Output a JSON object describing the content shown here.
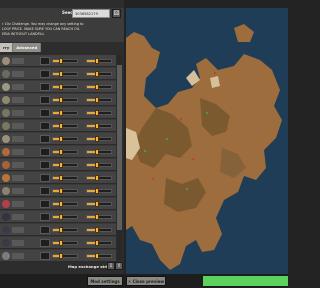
{
  "seed": {
    "label": "Seed",
    "value": "3036582179",
    "random_icon": "dice-icon"
  },
  "notice": {
    "lines": [
      "r 10x Challenge. You may change any setting to",
      "LOGY PRICE. MAKE SURE YOU CAN REACH OIL",
      "ERIA WITHOUT LANDFILL"
    ]
  },
  "tabs": [
    {
      "label": "rry",
      "active": false
    },
    {
      "label": "Advanced",
      "active": true
    }
  ],
  "resource_rows": [
    {
      "icon": "stone-ore-icon",
      "color": "#9a8f7a",
      "freq": 0.35,
      "size": 0.4
    },
    {
      "icon": "coal-ore-icon",
      "color": "#6c6a5e",
      "freq": 0.35,
      "size": 0.4
    },
    {
      "icon": "stone-ore-icon",
      "color": "#9b9a80",
      "freq": 0.35,
      "size": 0.4
    },
    {
      "icon": "stone-ore-icon",
      "color": "#8e8a72",
      "freq": 0.35,
      "size": 0.4
    },
    {
      "icon": "coal-ore-icon",
      "color": "#767763",
      "freq": 0.35,
      "size": 0.4
    },
    {
      "icon": "coal-ore-icon",
      "color": "#7a7860",
      "freq": 0.35,
      "size": 0.4
    },
    {
      "icon": "iron-ore-icon",
      "color": "#9a8f78",
      "freq": 0.35,
      "size": 0.4
    },
    {
      "icon": "copper-ore-icon",
      "color": "#b16a3a",
      "freq": 0.35,
      "size": 0.4
    },
    {
      "icon": "copper-ore-icon",
      "color": "#a8623a",
      "freq": 0.35,
      "size": 0.4
    },
    {
      "icon": "copper-ore-icon",
      "color": "#b9743c",
      "freq": 0.35,
      "size": 0.4
    },
    {
      "icon": "iron-ore-icon",
      "color": "#8c8272",
      "freq": 0.35,
      "size": 0.4
    },
    {
      "icon": "uranium-ore-icon",
      "color": "#b43f4c",
      "freq": 0.35,
      "size": 0.4
    },
    {
      "icon": "crude-oil-icon",
      "color": "#34323e",
      "freq": 0.35,
      "size": 0.4
    },
    {
      "icon": "crude-oil-icon",
      "color": "#3c3a48",
      "freq": 0.35,
      "size": 0.4
    },
    {
      "icon": "crude-oil-icon",
      "color": "#3a3a46",
      "freq": 0.35,
      "size": 0.4
    },
    {
      "icon": "enemy-base-icon",
      "color": "#7f7a7b",
      "freq": 0.35,
      "size": 0.4
    }
  ],
  "exchange": {
    "label": "Map exchange string",
    "import_icon": "import-icon",
    "export_icon": "export-icon"
  },
  "bottom": {
    "mod_settings": "Mod settings",
    "close_preview": "✕ Close preview",
    "confirm_color": "#5cd35f"
  }
}
